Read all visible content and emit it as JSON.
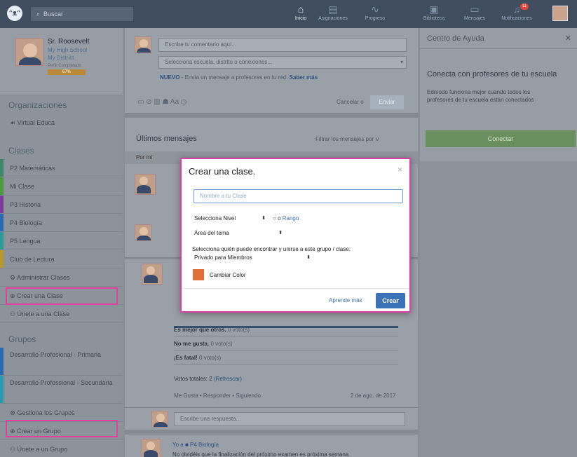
{
  "topbar": {
    "logo": "ᵔᴥᵔ",
    "search_placeholder": "Buscar",
    "nav": [
      {
        "icon": "home-icon",
        "glyph": "⌂",
        "label": "Inicio",
        "active": true
      },
      {
        "icon": "assignments-icon",
        "glyph": "▤",
        "label": "Asignaciones",
        "active": false
      },
      {
        "icon": "progress-icon",
        "glyph": "∿",
        "label": "Progreso",
        "active": false
      },
      {
        "icon": "library-icon",
        "glyph": "▣",
        "label": "Biblioteca",
        "active": false
      },
      {
        "icon": "messages-icon",
        "glyph": "▭",
        "label": "Mensajes",
        "active": false
      },
      {
        "icon": "notifications-icon",
        "glyph": "♫",
        "label": "Notificaciones",
        "active": false,
        "badge": "11"
      }
    ]
  },
  "profile": {
    "name": "Sr. Roosevelt",
    "school": "My High School",
    "district": "My District",
    "progress_label": "Perfil Completado",
    "progress_value": "67%"
  },
  "sidebar": {
    "organizations_title": "Organizaciones",
    "organization": "Virtual Educa",
    "classes_title": "Clases",
    "classes": [
      {
        "label": "P2 Matemáticas",
        "color": "#3a8a6a"
      },
      {
        "label": "Mi Clase",
        "color": "#4a9a3a"
      },
      {
        "label": "P3 Historia",
        "color": "#7a3a9a"
      },
      {
        "label": "P4 Biología",
        "color": "#2a6ab0"
      },
      {
        "label": "P5 Lengua",
        "color": "#2a9a9a"
      },
      {
        "label": "Club de Lectura",
        "color": "#b89a2a"
      }
    ],
    "manage_classes": "Administrar Clases",
    "create_class": "Crear una Clase",
    "join_class": "Únete a una Clase",
    "groups_title": "Grupos",
    "groups": [
      {
        "label": "Desarrollo Profesional - Primaria",
        "color": "#2a6ab0"
      },
      {
        "label": "Desarrollo Professional - Secundaria",
        "color": "#2a9ab0"
      }
    ],
    "manage_groups": "Gestiona los Grupos",
    "create_group": "Crear un Grupo",
    "join_group": "Únete a un Grupo"
  },
  "composer": {
    "placeholder": "Escribe tu comentario aquí...",
    "recipients_placeholder": "Selecciona escuela, distrito o conexiones...",
    "new_label": "NUEVO",
    "new_text": " - Envía un mensaje a profesores en tu red. ",
    "learn_more": "Saber más",
    "tools": "▭ ⊘ ▥ ☗ Aa ◷",
    "cancel": "Cancelar o",
    "send": "Enviar"
  },
  "feed": {
    "title": "Últimos mensajes",
    "filter": "Filtrar los mensajes por ∨",
    "by_me": "Por mí",
    "poll_options": [
      {
        "label": "Es mejor que otros.",
        "votes": "0 voto(s)"
      },
      {
        "label": "No me gusta.",
        "votes": "0 voto(s)"
      },
      {
        "label": "¡Es fatal!",
        "votes": "0 voto(s)"
      }
    ],
    "total_votes": "Votos totales: 2",
    "refresh": "(Refrescar)",
    "actions": "Me Gusta  •  Responder  •  Siguiendo",
    "date": "2 de ago. de 2017",
    "reply_placeholder": "Escribe una respuesta...",
    "last_post_to": "Yo a",
    "last_post_class": "P4 Biología",
    "last_post_text": "No olvidéis que la finalización del próximo examen es próxima semana"
  },
  "help": {
    "title": "Centro de Ayuda",
    "headline": "Conecta con profesores de tu escuela",
    "body": "Edmodo funciona mejor cuando todos los profesores de tu escuela están conectados",
    "connect": "Conectar"
  },
  "modal": {
    "title": "Crear una clase.",
    "name_placeholder": "Nombre a tu Clase",
    "level": "Selecciona Nivel",
    "or": "o",
    "range": "Rango",
    "subject": "Área del tema",
    "privacy_label": "Selecciona quién puede encontrar y unirse a este grupo / clase:",
    "privacy_value": "Privado para Miembros",
    "change_color": "Cambiar Color",
    "swatch_color": "#e06e38",
    "learn_more": "Aprende más",
    "create": "Crear"
  }
}
